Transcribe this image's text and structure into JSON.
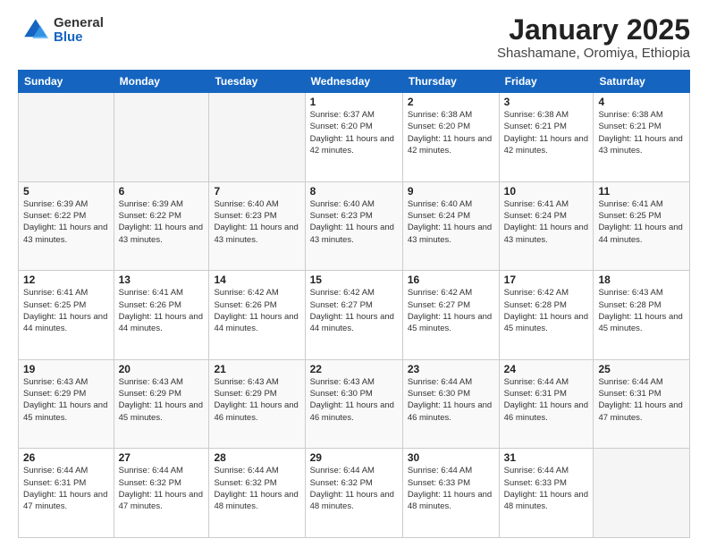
{
  "header": {
    "logo_general": "General",
    "logo_blue": "Blue",
    "title": "January 2025",
    "subtitle": "Shashamane, Oromiya, Ethiopia"
  },
  "days_of_week": [
    "Sunday",
    "Monday",
    "Tuesday",
    "Wednesday",
    "Thursday",
    "Friday",
    "Saturday"
  ],
  "weeks": [
    [
      {
        "day": "",
        "sunrise": "",
        "sunset": "",
        "daylight": "",
        "empty": true
      },
      {
        "day": "",
        "sunrise": "",
        "sunset": "",
        "daylight": "",
        "empty": true
      },
      {
        "day": "",
        "sunrise": "",
        "sunset": "",
        "daylight": "",
        "empty": true
      },
      {
        "day": "1",
        "sunrise": "Sunrise: 6:37 AM",
        "sunset": "Sunset: 6:20 PM",
        "daylight": "Daylight: 11 hours and 42 minutes.",
        "empty": false
      },
      {
        "day": "2",
        "sunrise": "Sunrise: 6:38 AM",
        "sunset": "Sunset: 6:20 PM",
        "daylight": "Daylight: 11 hours and 42 minutes.",
        "empty": false
      },
      {
        "day": "3",
        "sunrise": "Sunrise: 6:38 AM",
        "sunset": "Sunset: 6:21 PM",
        "daylight": "Daylight: 11 hours and 42 minutes.",
        "empty": false
      },
      {
        "day": "4",
        "sunrise": "Sunrise: 6:38 AM",
        "sunset": "Sunset: 6:21 PM",
        "daylight": "Daylight: 11 hours and 43 minutes.",
        "empty": false
      }
    ],
    [
      {
        "day": "5",
        "sunrise": "Sunrise: 6:39 AM",
        "sunset": "Sunset: 6:22 PM",
        "daylight": "Daylight: 11 hours and 43 minutes.",
        "empty": false
      },
      {
        "day": "6",
        "sunrise": "Sunrise: 6:39 AM",
        "sunset": "Sunset: 6:22 PM",
        "daylight": "Daylight: 11 hours and 43 minutes.",
        "empty": false
      },
      {
        "day": "7",
        "sunrise": "Sunrise: 6:40 AM",
        "sunset": "Sunset: 6:23 PM",
        "daylight": "Daylight: 11 hours and 43 minutes.",
        "empty": false
      },
      {
        "day": "8",
        "sunrise": "Sunrise: 6:40 AM",
        "sunset": "Sunset: 6:23 PM",
        "daylight": "Daylight: 11 hours and 43 minutes.",
        "empty": false
      },
      {
        "day": "9",
        "sunrise": "Sunrise: 6:40 AM",
        "sunset": "Sunset: 6:24 PM",
        "daylight": "Daylight: 11 hours and 43 minutes.",
        "empty": false
      },
      {
        "day": "10",
        "sunrise": "Sunrise: 6:41 AM",
        "sunset": "Sunset: 6:24 PM",
        "daylight": "Daylight: 11 hours and 43 minutes.",
        "empty": false
      },
      {
        "day": "11",
        "sunrise": "Sunrise: 6:41 AM",
        "sunset": "Sunset: 6:25 PM",
        "daylight": "Daylight: 11 hours and 44 minutes.",
        "empty": false
      }
    ],
    [
      {
        "day": "12",
        "sunrise": "Sunrise: 6:41 AM",
        "sunset": "Sunset: 6:25 PM",
        "daylight": "Daylight: 11 hours and 44 minutes.",
        "empty": false
      },
      {
        "day": "13",
        "sunrise": "Sunrise: 6:41 AM",
        "sunset": "Sunset: 6:26 PM",
        "daylight": "Daylight: 11 hours and 44 minutes.",
        "empty": false
      },
      {
        "day": "14",
        "sunrise": "Sunrise: 6:42 AM",
        "sunset": "Sunset: 6:26 PM",
        "daylight": "Daylight: 11 hours and 44 minutes.",
        "empty": false
      },
      {
        "day": "15",
        "sunrise": "Sunrise: 6:42 AM",
        "sunset": "Sunset: 6:27 PM",
        "daylight": "Daylight: 11 hours and 44 minutes.",
        "empty": false
      },
      {
        "day": "16",
        "sunrise": "Sunrise: 6:42 AM",
        "sunset": "Sunset: 6:27 PM",
        "daylight": "Daylight: 11 hours and 45 minutes.",
        "empty": false
      },
      {
        "day": "17",
        "sunrise": "Sunrise: 6:42 AM",
        "sunset": "Sunset: 6:28 PM",
        "daylight": "Daylight: 11 hours and 45 minutes.",
        "empty": false
      },
      {
        "day": "18",
        "sunrise": "Sunrise: 6:43 AM",
        "sunset": "Sunset: 6:28 PM",
        "daylight": "Daylight: 11 hours and 45 minutes.",
        "empty": false
      }
    ],
    [
      {
        "day": "19",
        "sunrise": "Sunrise: 6:43 AM",
        "sunset": "Sunset: 6:29 PM",
        "daylight": "Daylight: 11 hours and 45 minutes.",
        "empty": false
      },
      {
        "day": "20",
        "sunrise": "Sunrise: 6:43 AM",
        "sunset": "Sunset: 6:29 PM",
        "daylight": "Daylight: 11 hours and 45 minutes.",
        "empty": false
      },
      {
        "day": "21",
        "sunrise": "Sunrise: 6:43 AM",
        "sunset": "Sunset: 6:29 PM",
        "daylight": "Daylight: 11 hours and 46 minutes.",
        "empty": false
      },
      {
        "day": "22",
        "sunrise": "Sunrise: 6:43 AM",
        "sunset": "Sunset: 6:30 PM",
        "daylight": "Daylight: 11 hours and 46 minutes.",
        "empty": false
      },
      {
        "day": "23",
        "sunrise": "Sunrise: 6:44 AM",
        "sunset": "Sunset: 6:30 PM",
        "daylight": "Daylight: 11 hours and 46 minutes.",
        "empty": false
      },
      {
        "day": "24",
        "sunrise": "Sunrise: 6:44 AM",
        "sunset": "Sunset: 6:31 PM",
        "daylight": "Daylight: 11 hours and 46 minutes.",
        "empty": false
      },
      {
        "day": "25",
        "sunrise": "Sunrise: 6:44 AM",
        "sunset": "Sunset: 6:31 PM",
        "daylight": "Daylight: 11 hours and 47 minutes.",
        "empty": false
      }
    ],
    [
      {
        "day": "26",
        "sunrise": "Sunrise: 6:44 AM",
        "sunset": "Sunset: 6:31 PM",
        "daylight": "Daylight: 11 hours and 47 minutes.",
        "empty": false
      },
      {
        "day": "27",
        "sunrise": "Sunrise: 6:44 AM",
        "sunset": "Sunset: 6:32 PM",
        "daylight": "Daylight: 11 hours and 47 minutes.",
        "empty": false
      },
      {
        "day": "28",
        "sunrise": "Sunrise: 6:44 AM",
        "sunset": "Sunset: 6:32 PM",
        "daylight": "Daylight: 11 hours and 48 minutes.",
        "empty": false
      },
      {
        "day": "29",
        "sunrise": "Sunrise: 6:44 AM",
        "sunset": "Sunset: 6:32 PM",
        "daylight": "Daylight: 11 hours and 48 minutes.",
        "empty": false
      },
      {
        "day": "30",
        "sunrise": "Sunrise: 6:44 AM",
        "sunset": "Sunset: 6:33 PM",
        "daylight": "Daylight: 11 hours and 48 minutes.",
        "empty": false
      },
      {
        "day": "31",
        "sunrise": "Sunrise: 6:44 AM",
        "sunset": "Sunset: 6:33 PM",
        "daylight": "Daylight: 11 hours and 48 minutes.",
        "empty": false
      },
      {
        "day": "",
        "sunrise": "",
        "sunset": "",
        "daylight": "",
        "empty": true
      }
    ]
  ]
}
